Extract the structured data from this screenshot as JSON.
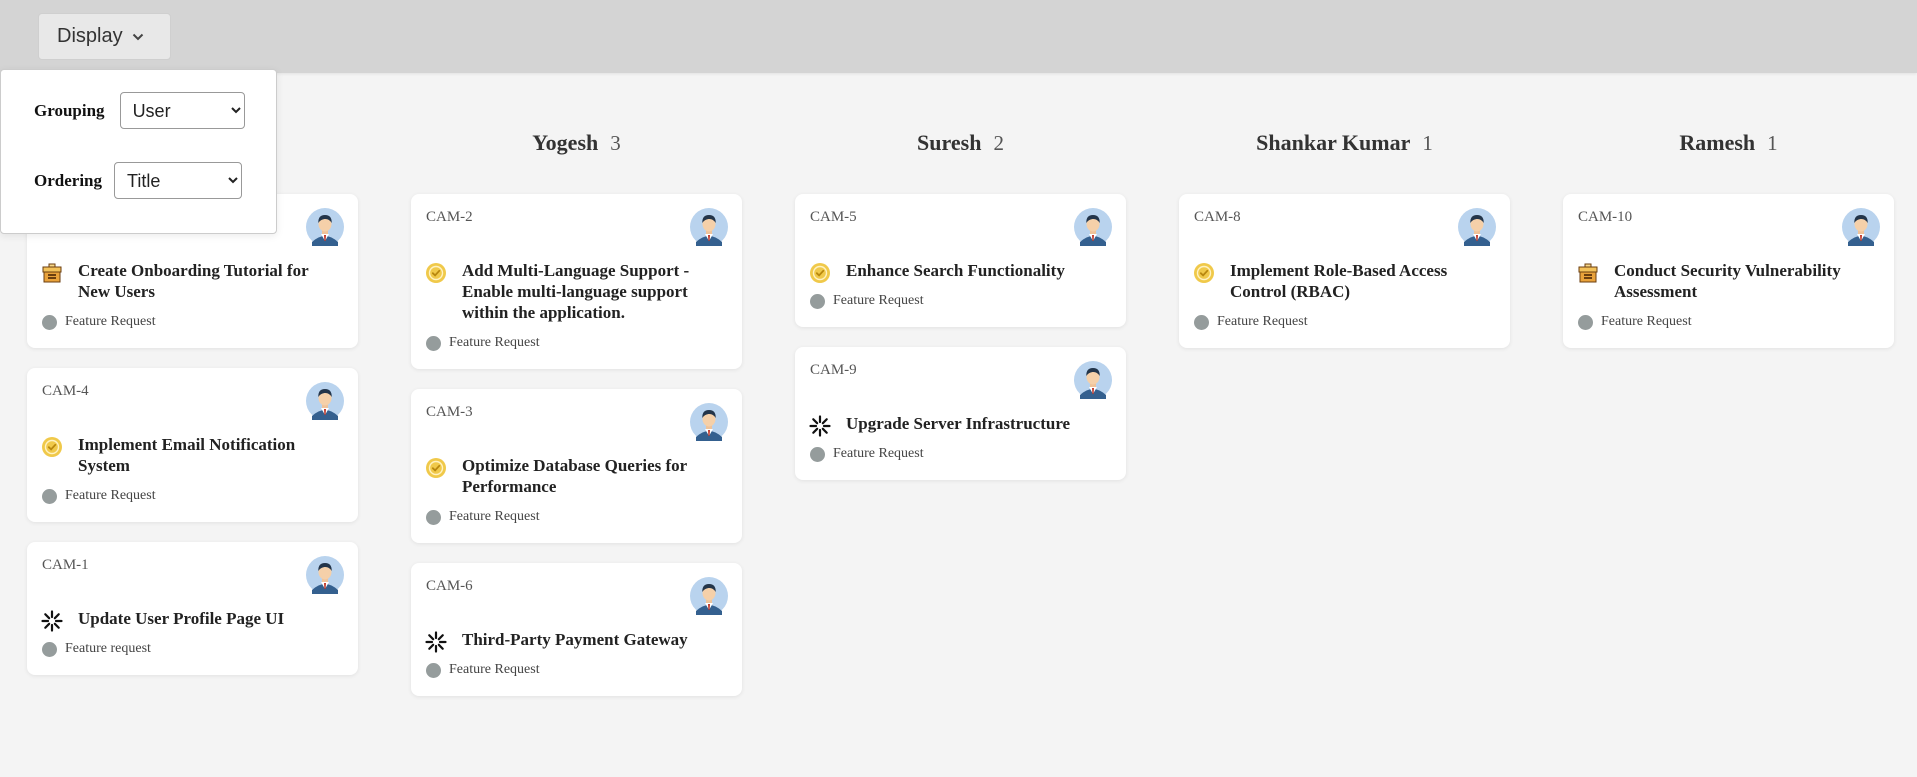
{
  "toolbar": {
    "display_label": "Display"
  },
  "dropdown": {
    "grouping_label": "Grouping",
    "grouping_value": "User",
    "ordering_label": "Ordering",
    "ordering_value": "Title"
  },
  "columns": [
    {
      "name": "",
      "count": "",
      "cards": [
        {
          "id": "",
          "title": "Create Onboarding Tutorial for New Users",
          "tag": "Feature Request",
          "status": "backlog"
        },
        {
          "id": "CAM-4",
          "title": "Implement Email Notification System",
          "tag": "Feature Request",
          "status": "todo"
        },
        {
          "id": "CAM-1",
          "title": "Update User Profile Page UI",
          "tag": "Feature request",
          "status": "in-progress"
        }
      ]
    },
    {
      "name": "Yogesh",
      "count": "3",
      "cards": [
        {
          "id": "CAM-2",
          "title": "Add Multi-Language Support - Enable multi-language support within the application.",
          "tag": "Feature Request",
          "status": "todo"
        },
        {
          "id": "CAM-3",
          "title": "Optimize Database Queries for Performance",
          "tag": "Feature Request",
          "status": "todo"
        },
        {
          "id": "CAM-6",
          "title": "Third-Party Payment Gateway",
          "tag": "Feature Request",
          "status": "in-progress"
        }
      ]
    },
    {
      "name": "Suresh",
      "count": "2",
      "cards": [
        {
          "id": "CAM-5",
          "title": "Enhance Search Functionality",
          "tag": "Feature Request",
          "status": "todo"
        },
        {
          "id": "CAM-9",
          "title": "Upgrade Server Infrastructure",
          "tag": "Feature Request",
          "status": "in-progress"
        }
      ]
    },
    {
      "name": "Shankar Kumar",
      "count": "1",
      "cards": [
        {
          "id": "CAM-8",
          "title": "Implement Role-Based Access Control (RBAC)",
          "tag": "Feature Request",
          "status": "todo"
        }
      ]
    },
    {
      "name": "Ramesh",
      "count": "1",
      "cards": [
        {
          "id": "CAM-10",
          "title": "Conduct Security Vulnerability Assessment",
          "tag": "Feature Request",
          "status": "backlog"
        }
      ]
    }
  ],
  "colors": {
    "topbar": "#d4d4d4",
    "background": "#f4f4f4",
    "todo_icon": "#f0c94a",
    "tag_dot": "#959c9c",
    "avatar_bg": "#b9d3ee"
  }
}
